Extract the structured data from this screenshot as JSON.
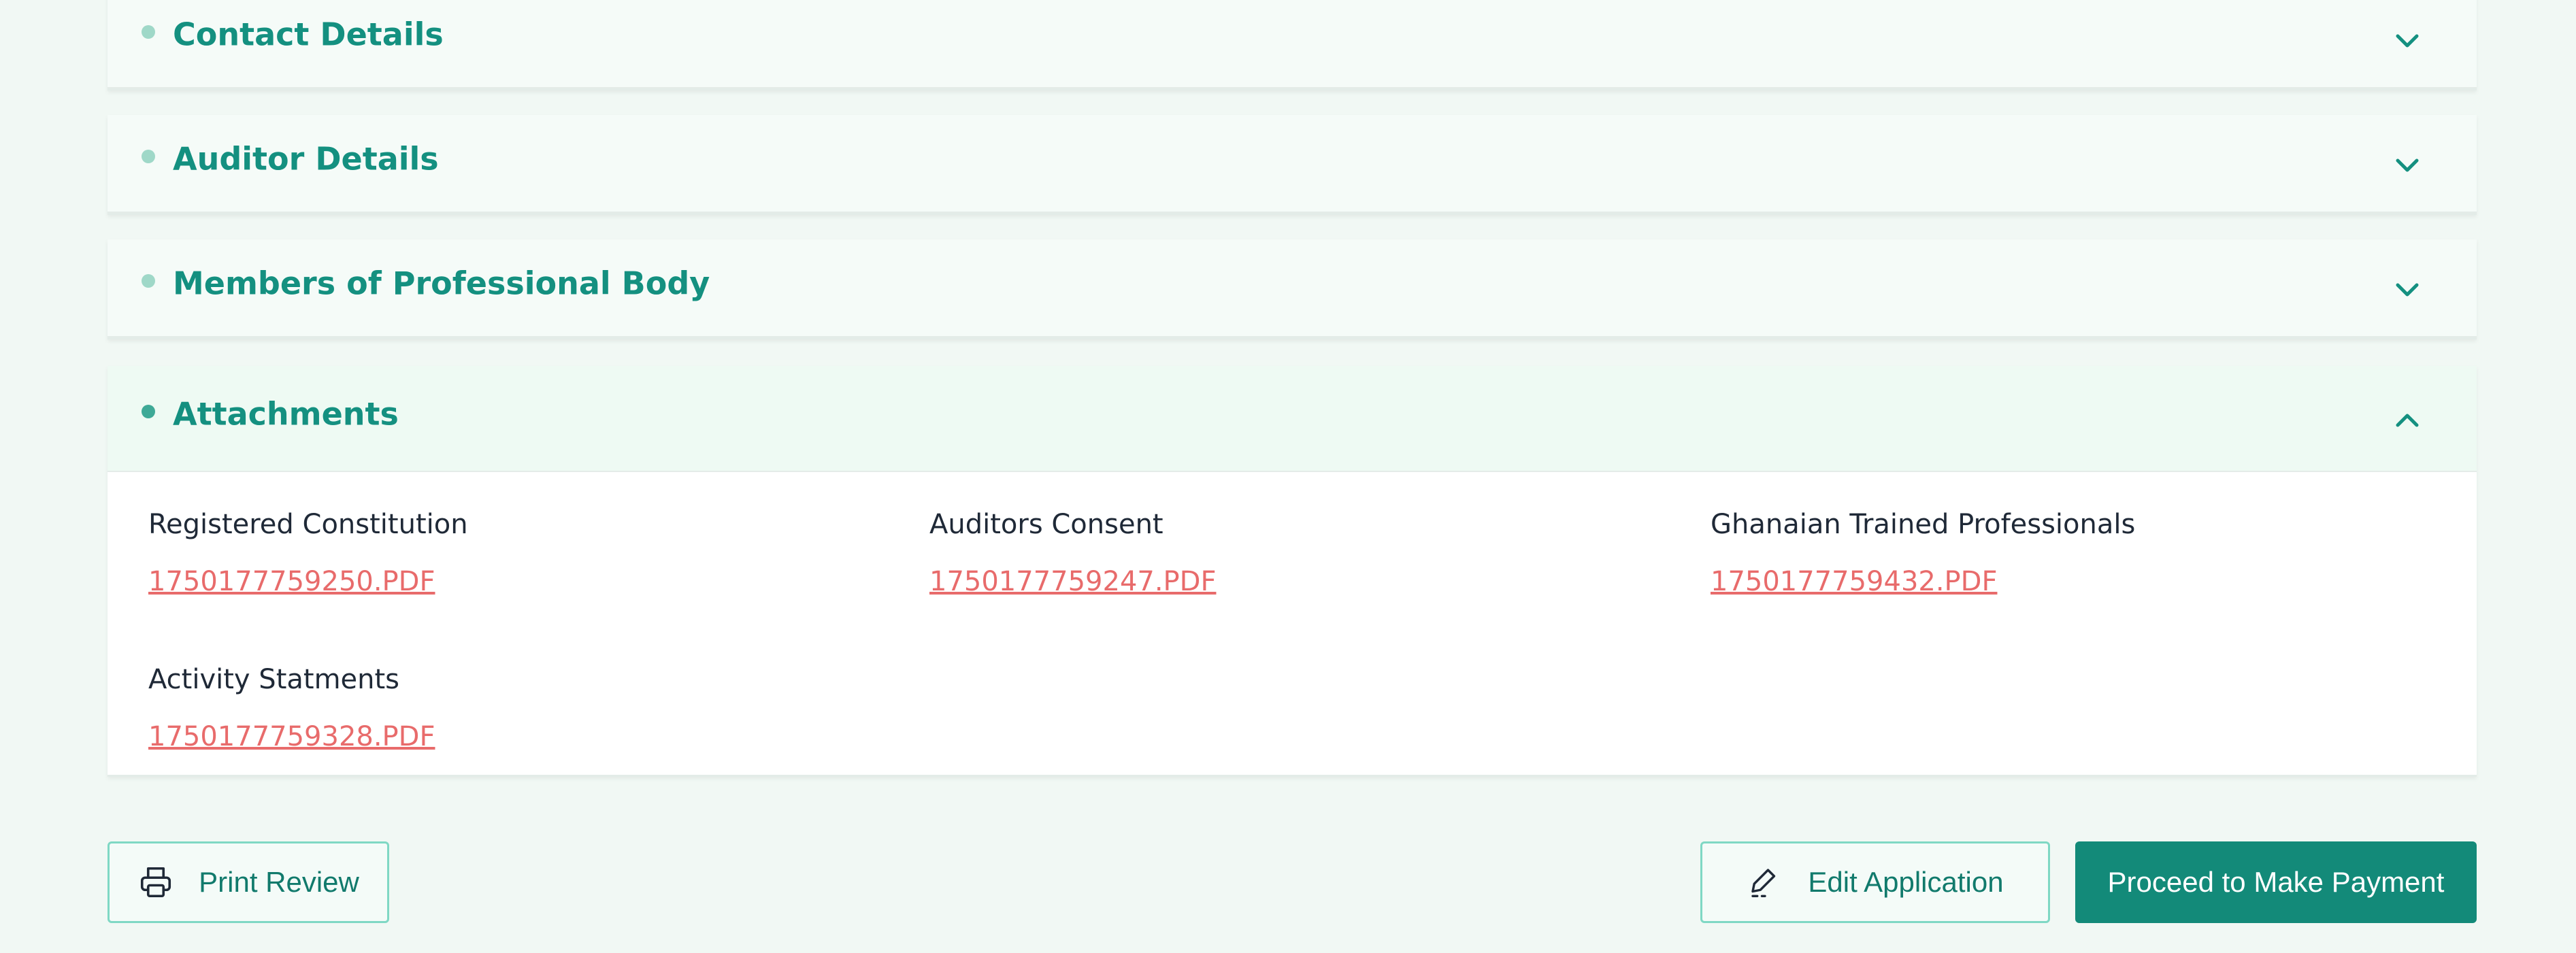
{
  "sections": [
    {
      "title": "Contact Details",
      "state": "collapsed"
    },
    {
      "title": "Auditor Details",
      "state": "collapsed"
    },
    {
      "title": "Members of Professional Body",
      "state": "collapsed"
    },
    {
      "title": "Attachments",
      "state": "expanded"
    }
  ],
  "attachments": [
    {
      "label": "Registered Constitution",
      "file": "1750177759250.PDF"
    },
    {
      "label": "Auditors Consent",
      "file": "1750177759247.PDF"
    },
    {
      "label": "Ghanaian Trained Professionals",
      "file": "1750177759432.PDF"
    },
    {
      "label": "Activity Statments",
      "file": "1750177759328.PDF"
    }
  ],
  "actions": {
    "print": "Print Review",
    "edit": "Edit Application",
    "proceed": "Proceed to Make Payment"
  },
  "icons": {
    "section_collapsed": "chevron-down-icon",
    "section_expanded": "chevron-up-icon",
    "print": "printer-icon",
    "edit": "pencil-icon"
  },
  "colors": {
    "accent": "#149080",
    "primary_button": "#138a79",
    "link": "#e86b6b",
    "page_background": "#f1f8f4"
  }
}
